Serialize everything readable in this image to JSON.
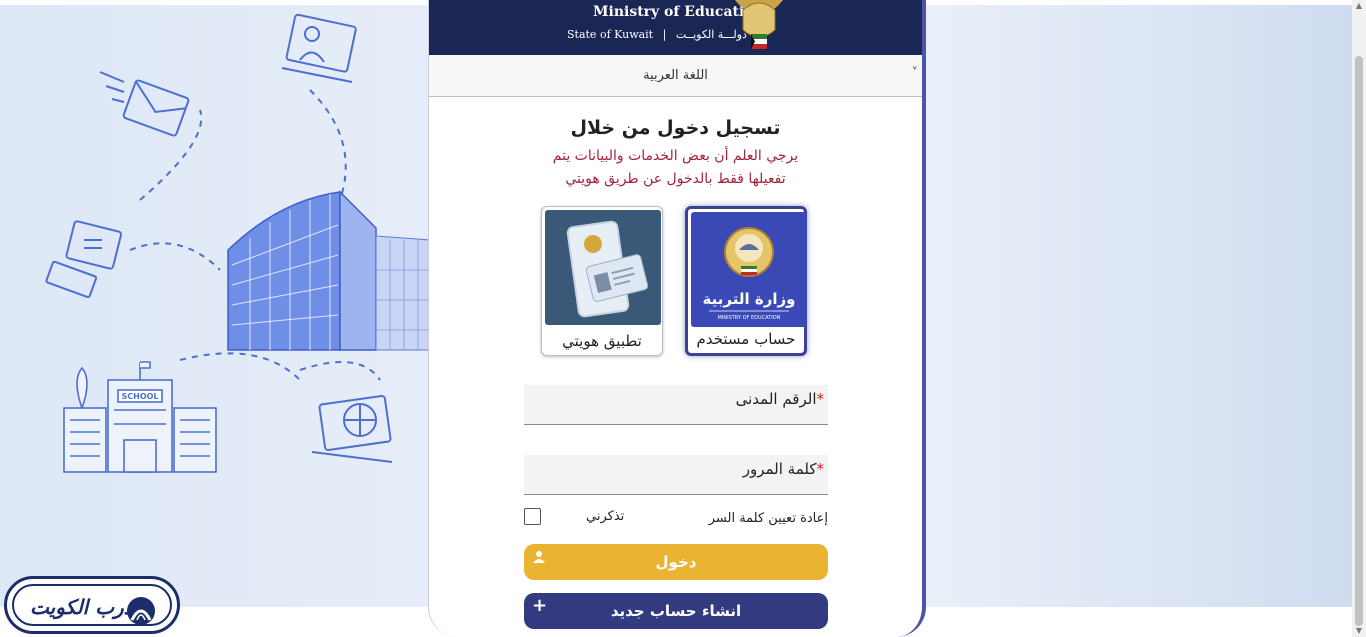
{
  "header": {
    "ministry_en": "Ministry of Education",
    "state_en": "State of Kuwait",
    "state_ar": "دولـــة الكويــت",
    "separator": "|"
  },
  "language": {
    "label": "اللغة العربية",
    "chevron": "˅"
  },
  "login": {
    "title": "تسجيل دخول من خلال",
    "notice_line1": "يرجي العلم أن بعض الخدمات والبيانات يتم",
    "notice_line2": "تفعيلها فقط بالدخول عن طريق هويتي"
  },
  "options": [
    {
      "label": "حساب مستخدم",
      "brand_ar": "وزارة التربية",
      "brand_en": "MINISTRY OF EDUCATION",
      "selected": true
    },
    {
      "label": "تطبيق هويتي",
      "selected": false
    }
  ],
  "form": {
    "civil_id_label": "الرقم المدنى",
    "password_label": "كلمة المرور",
    "required_mark": "*",
    "forgot_password": "إعادة تعيين كلمة السر",
    "remember_me": "تذكرني",
    "login_button": "دخول",
    "register_button": "انشاء حساب جديد",
    "login_icon": "user-icon",
    "register_icon": "plus-icon",
    "plus_glyph": "+"
  },
  "watermark": {
    "text": "درب الكويت"
  },
  "illustration": {
    "school_sign": "SCHOOL"
  },
  "colors": {
    "header_bg": "#1a2654",
    "notice": "#a3243a",
    "login_button": "#eab432",
    "register_button": "#323b80",
    "card_border": "#4b54a8"
  }
}
